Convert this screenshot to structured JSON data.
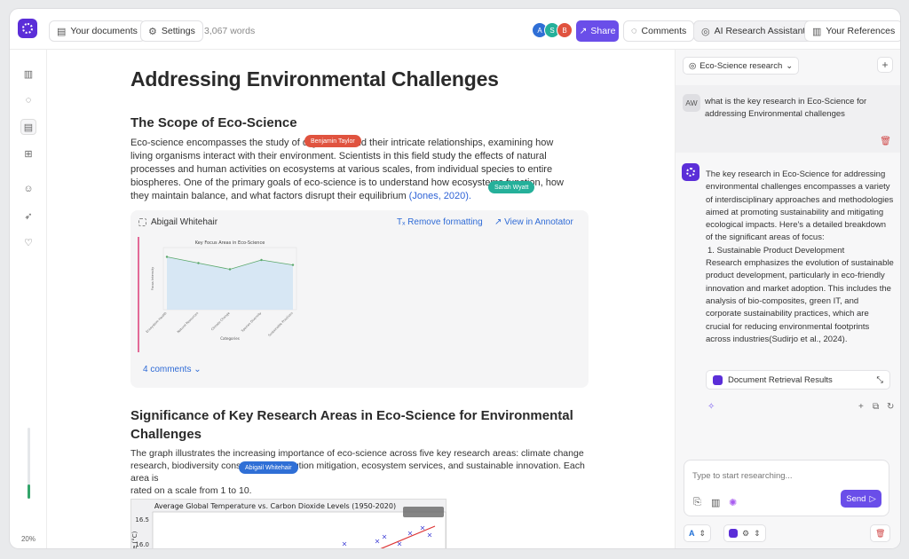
{
  "topbar": {
    "your_documents": "Your documents",
    "settings": "Settings",
    "word_count": "3,067 words",
    "avatars": [
      {
        "initial": "A",
        "color": "#2f6fd6"
      },
      {
        "initial": "S",
        "color": "#25b09a"
      },
      {
        "initial": "B",
        "color": "#e0533f"
      }
    ],
    "share": "Share",
    "comments": "Comments",
    "ai_assistant": "AI Research Assistant",
    "references": "Your References"
  },
  "rail": {
    "progress_percent": 20,
    "progress_label": "20%",
    "user_initials": "AW",
    "icons": [
      "library-icon",
      "chat-icon",
      "document-icon",
      "apps-icon",
      "users-icon",
      "rocket-icon",
      "heart-icon"
    ]
  },
  "document": {
    "title": "Addressing Environmental Challenges",
    "section1_heading": "The Scope of Eco-Science",
    "section1_lines": [
      "Eco-science encompasses the study of organisms and their intricate relationships, examining how",
      "living organisms interact with their environment. Scientists in this field study the effects of natural",
      "processes and human activities on ecosystems at various scales, from individual species to entire",
      "biospheres. One of the primary goals of eco-science is to understand how ecosystems function, how"
    ],
    "section1_last_line": "they maintain balance, and what factors disrupt their equilibrium ",
    "section1_citation": "(Jones, 2020).",
    "collab_tags": [
      {
        "name": "Benjamin Taylor",
        "color": "#e0533f"
      },
      {
        "name": "Sarah Wyatt",
        "color": "#25b09a"
      },
      {
        "name": "Abigail Whitehair",
        "color": "#2f6fd6"
      }
    ],
    "annotation_card": {
      "author": "Abigail Whitehair",
      "remove_formatting": "Remove formatting",
      "view_annotator": "View in Annotator",
      "comments_link": "4 comments"
    },
    "section2_heading_line1": "Significance of Key Research Areas in Eco-Science for Environmental",
    "section2_heading_line2": "Challenges",
    "section2_lines": [
      "The graph illustrates the increasing importance of eco-science across five key research areas: climate change",
      "research, biodiversity conservation, pollution mitigation, ecosystem services, and sustainable innovation. Each area is",
      "rated on a scale from 1 to 10."
    ],
    "figure2_title": "Average Global Temperature vs. Carbon Dioxide Levels (1950-2020)",
    "figure2_yticks": [
      "16.5",
      "16.0"
    ],
    "figure2_ylabel": "e (°C)"
  },
  "chart_data": [
    {
      "type": "area",
      "title": "Key Focus Areas in Eco-Science",
      "xlabel": "Categories",
      "ylabel": "Focus Intensity",
      "categories": [
        "Ecosystem Health",
        "Natural Resources",
        "Climate Change",
        "Species Diversity",
        "Sustainable Practices"
      ],
      "values": [
        8.5,
        7.5,
        6.5,
        8.0,
        7.2
      ],
      "ylim": [
        0,
        10
      ]
    }
  ],
  "assistant": {
    "collection": "Eco-Science research",
    "user_initials": "AW",
    "question": "what is the key research in Eco-Science for addressing Environmental challenges",
    "answer_intro": "The key research in Eco-Science for addressing environmental challenges encompasses a variety of interdisciplinary approaches and methodologies aimed at promoting sustainability and mitigating ecological impacts. Here's a detailed breakdown of the significant areas of focus:",
    "answer_item": "1.  Sustainable Product Development",
    "answer_body": "Research emphasizes the evolution of sustainable product development, particularly in eco-friendly innovation and market adoption. This includes the analysis of bio-composites, green IT, and corporate sustainability practices, which are crucial for reducing environmental footprints across industries(Sudirjo et al., 2024).",
    "doc_results": "Document Retrieval Results",
    "input_placeholder": "Type to start researching...",
    "send": "Send"
  }
}
